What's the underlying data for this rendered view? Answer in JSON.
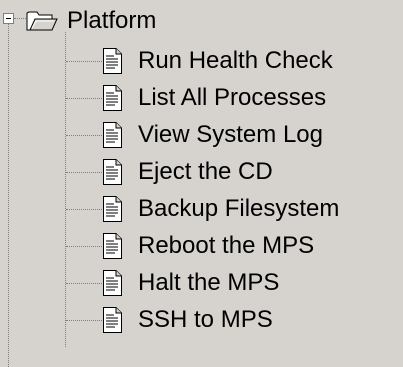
{
  "tree": {
    "root": {
      "label": "Platform",
      "expanded": true,
      "icon": "folder-open-icon"
    },
    "items": [
      {
        "label": "Run Health Check",
        "icon": "document-icon"
      },
      {
        "label": "List All Processes",
        "icon": "document-icon"
      },
      {
        "label": "View System Log",
        "icon": "document-icon"
      },
      {
        "label": "Eject the CD",
        "icon": "document-icon"
      },
      {
        "label": "Backup Filesystem",
        "icon": "document-icon"
      },
      {
        "label": "Reboot the MPS",
        "icon": "document-icon"
      },
      {
        "label": "Halt the MPS",
        "icon": "document-icon"
      },
      {
        "label": "SSH to MPS",
        "icon": "document-icon"
      }
    ]
  },
  "colors": {
    "background": "#d6d3ce",
    "connector": "#7f7f7f",
    "text": "#000000"
  }
}
